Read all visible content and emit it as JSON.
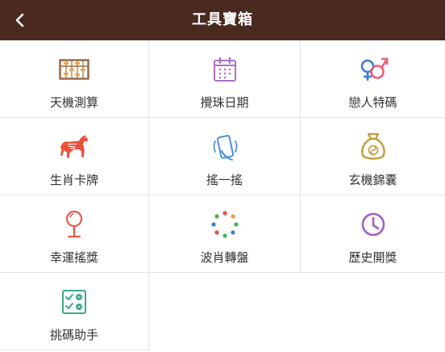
{
  "header": {
    "title": "工具寶箱",
    "background": "#4a2a20"
  },
  "tools": [
    {
      "label": "天機測算",
      "icon": "abacus-icon",
      "color": "#9b6a45"
    },
    {
      "label": "攪珠日期",
      "icon": "calendar-icon",
      "color": "#b06ec9"
    },
    {
      "label": "戀人特碼",
      "icon": "gender-symbols-icon",
      "color": "#3b7fd8"
    },
    {
      "label": "生肖卡牌",
      "icon": "horse-icon",
      "color": "#e9503a"
    },
    {
      "label": "搖一搖",
      "icon": "shaking-phone-icon",
      "color": "#4a90d9"
    },
    {
      "label": "玄機錦囊",
      "icon": "money-bag-icon",
      "color": "#c59a3c"
    },
    {
      "label": "幸運搖獎",
      "icon": "lollipop-icon",
      "color": "#e95a4f"
    },
    {
      "label": "波肖轉盤",
      "icon": "dot-wheel-icon",
      "color": "#4caf50"
    },
    {
      "label": "歷史開獎",
      "icon": "clock-icon",
      "color": "#a25ec8"
    },
    {
      "label": "挑碼助手",
      "icon": "checklist-icon",
      "color": "#3aaa8a"
    }
  ]
}
